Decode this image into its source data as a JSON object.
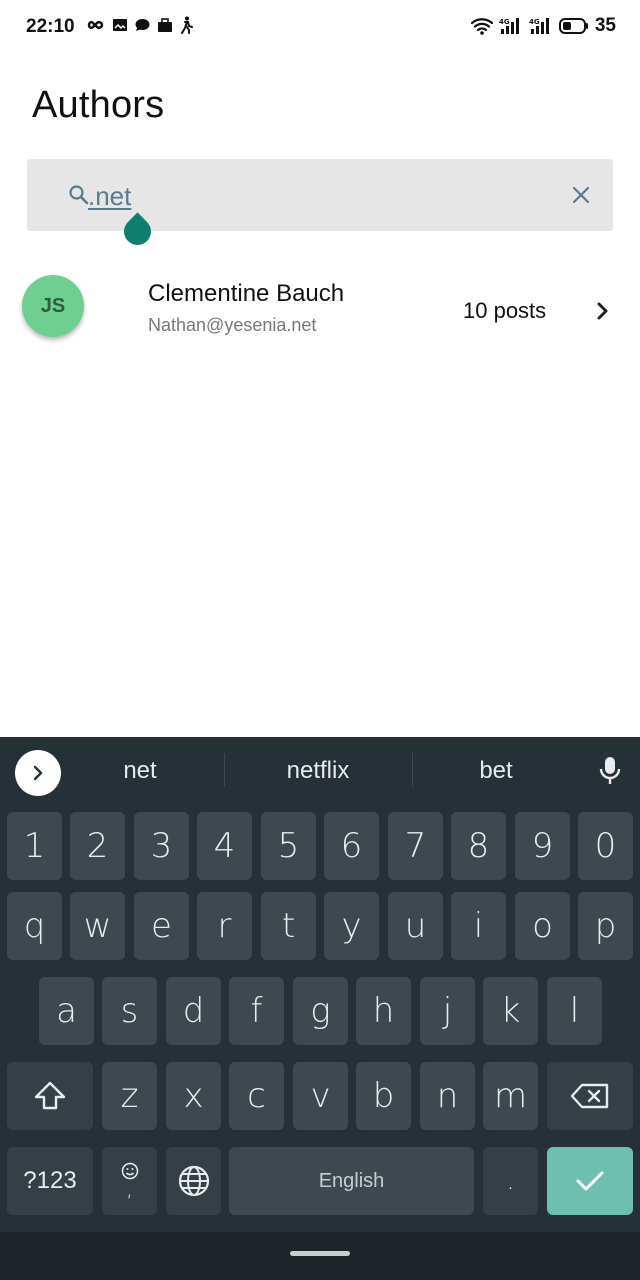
{
  "status_bar": {
    "time": "22:10",
    "battery": "35",
    "icons_left": [
      "infinity-icon",
      "picture-icon",
      "chat-icon",
      "briefcase-icon",
      "walking-icon"
    ],
    "icons_right": [
      "wifi-icon",
      "signal-4g-icon",
      "signal-4g-icon",
      "battery-icon"
    ]
  },
  "page": {
    "title": "Authors"
  },
  "search": {
    "value": ".net",
    "icon": "search-icon",
    "clear_icon": "close-icon"
  },
  "authors": [
    {
      "initials": "JS",
      "name": "Clementine Bauch",
      "email": "Nathan@yesenia.net",
      "posts": "10 posts",
      "avatar_color": "#6fcf90"
    }
  ],
  "keyboard": {
    "suggestions": [
      "net",
      "netflix",
      "bet"
    ],
    "rows": {
      "numbers": [
        "1",
        "2",
        "3",
        "4",
        "5",
        "6",
        "7",
        "8",
        "9",
        "0"
      ],
      "row1": [
        "q",
        "w",
        "e",
        "r",
        "t",
        "y",
        "u",
        "i",
        "o",
        "p"
      ],
      "row2": [
        "a",
        "s",
        "d",
        "f",
        "g",
        "h",
        "j",
        "k",
        "l"
      ],
      "row3": [
        "z",
        "x",
        "c",
        "v",
        "b",
        "n",
        "m"
      ]
    },
    "symbols_key": "?123",
    "emoji_comma_key": ",",
    "space_label": "English",
    "period_key": ".",
    "colors": {
      "background": "#263137",
      "key": "#3d494f",
      "done_key": "#6fbfae"
    }
  },
  "colors": {
    "accent": "#0f7d70",
    "search_bg": "#e6e6e6",
    "search_text": "#5a7b90"
  }
}
